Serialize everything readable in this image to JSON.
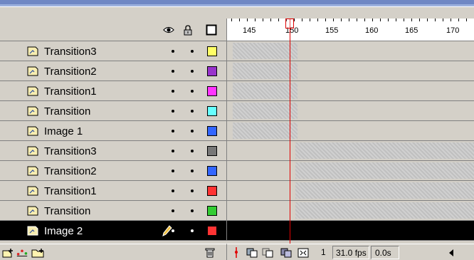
{
  "header": {
    "show_hide_icon": "eye-icon",
    "lock_icon": "padlock-icon",
    "outline_icon": "outline-square-icon",
    "frame_numbers": [
      "145",
      "150",
      "155",
      "160",
      "165",
      "170"
    ]
  },
  "layers": [
    {
      "name": "Transition3",
      "color": "#ffff66",
      "selected": false
    },
    {
      "name": "Transition2",
      "color": "#9933cc",
      "selected": false
    },
    {
      "name": "Transition1",
      "color": "#ff33ff",
      "selected": false
    },
    {
      "name": "Transition",
      "color": "#66ffff",
      "selected": false
    },
    {
      "name": "Image 1",
      "color": "#3366ff",
      "selected": false
    },
    {
      "name": "Transition3",
      "color": "#777777",
      "selected": false
    },
    {
      "name": "Transition2",
      "color": "#3366ff",
      "selected": false
    },
    {
      "name": "Transition1",
      "color": "#ff3333",
      "selected": false
    },
    {
      "name": "Transition",
      "color": "#33cc33",
      "selected": false
    },
    {
      "name": "Image 2",
      "color": "#ff3333",
      "selected": true
    }
  ],
  "toolbar": {
    "current_frame": "1",
    "frame_rate": "31.0 fps",
    "elapsed_time": "0.0s"
  }
}
